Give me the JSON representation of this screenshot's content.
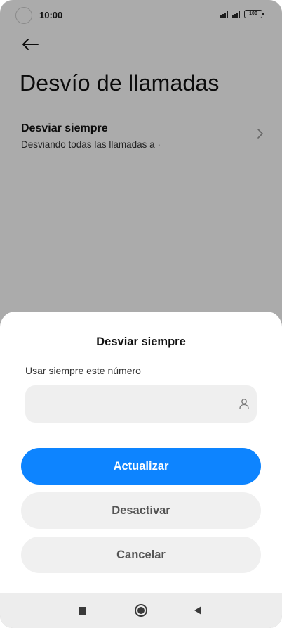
{
  "status_bar": {
    "time": "10:00",
    "battery": "100"
  },
  "page": {
    "title": "Desvío de llamadas",
    "item": {
      "title": "Desviar siempre",
      "subtitle": "Desviando todas las llamadas a ·"
    }
  },
  "sheet": {
    "title": "Desviar siempre",
    "field_label": "Usar siempre este número",
    "field_value": "",
    "primary_button": "Actualizar",
    "deactivate_button": "Desactivar",
    "cancel_button": "Cancelar"
  },
  "icons": {
    "back": "arrow-left-icon",
    "chevron": "chevron-right-icon",
    "contact": "person-icon",
    "nav_recents": "square-icon",
    "nav_home": "circle-icon",
    "nav_back": "triangle-back-icon"
  },
  "colors": {
    "accent": "#0d84ff",
    "secondary_button": "#f0f0f0",
    "field_bg": "#efefef"
  }
}
